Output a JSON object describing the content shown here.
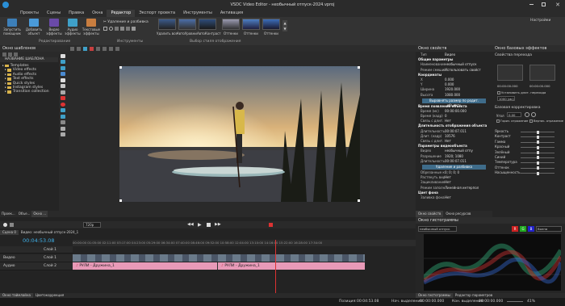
{
  "window": {
    "title": "VSDC Video Editor - необычный отпуск-2024.vproj"
  },
  "tabs": [
    "Проекты",
    "Сцены",
    "Правка",
    "Окна",
    "Редактор",
    "Экспорт проекта",
    "Инструменты",
    "Активация"
  ],
  "ribbon": {
    "start_assistant": "Запустить помощник",
    "add_object": "Добавить объект",
    "video_effects": "Видео эффекты",
    "audio_effects": "Аудио эффекты",
    "text_effects": "Текстовые эффекты",
    "group_editing": "Редактирование",
    "cut_split": "Удаление и разбивка",
    "group_tools": "Инструменты",
    "styles": [
      "Удалить все",
      "АвтоУровни",
      "АвтоКонтраст",
      "Оттенки",
      "Оттенки",
      "Оттенки"
    ],
    "group_styles": "Выбор стиля отображения",
    "settings_label": "Настройки"
  },
  "left_panel": {
    "title": "Окно шаблонов",
    "header": "НАЗВАНИЕ ШАБЛОНА",
    "items": [
      "Templates",
      "Video effects",
      "Audio effects",
      "Text effects",
      "Quick styles",
      "Instagram styles",
      "Transition collection"
    ],
    "bottom_tabs": [
      "Проек...",
      "Объе...",
      "Окно ..."
    ]
  },
  "props": {
    "title": "Окно свойств",
    "rows": [
      {
        "k": "Тип",
        "v": "Видео",
        "sec": false
      },
      {
        "k": "",
        "v": "",
        "sec": true,
        "label": "Общие параметры"
      },
      {
        "k": "Наименование",
        "v": "необычный отпуск"
      },
      {
        "k": "Режим смешивания",
        "v": "Использовать свойст"
      },
      {
        "k": "",
        "v": "",
        "sec": true,
        "label": "Координаты"
      },
      {
        "k": "X",
        "v": "0.000"
      },
      {
        "k": "Y",
        "v": "0.000"
      },
      {
        "k": "Ширина",
        "v": "1920.000"
      },
      {
        "k": "Высота",
        "v": "1080.000"
      }
    ],
    "btn1": "Выровнять размер по родит. объекту",
    "rows2": [
      {
        "k": "",
        "v": "",
        "sec": true,
        "label": "Время появления объекта"
      },
      {
        "k": "Время (мс)",
        "v": "00:00:00.000"
      },
      {
        "k": "Время (кадр)",
        "v": "0"
      },
      {
        "k": "Связь с длит.",
        "v": "Нет"
      },
      {
        "k": "",
        "v": "",
        "sec": true,
        "label": "Длительность отображения объекта"
      },
      {
        "k": "Длительность",
        "v": "00:00:07.011"
      },
      {
        "k": "Длит. (кадр)",
        "v": "10576"
      },
      {
        "k": "Связь с длит.",
        "v": "Нет"
      },
      {
        "k": "",
        "v": "",
        "sec": true,
        "label": "Параметры видеообъекта"
      },
      {
        "k": "Видео",
        "v": "необычный отпу"
      },
      {
        "k": "Разрешение",
        "v": "1920; 1080"
      },
      {
        "k": "Длительность",
        "v": "00:00:07.011"
      }
    ],
    "btn2": "Удаление и разбивка",
    "rows3": [
      {
        "k": "Обрезанные края",
        "v": "0; 0; 0; 0"
      },
      {
        "k": "Растянуть видео",
        "v": "Нет"
      },
      {
        "k": "Зацикливание",
        "v": "Нет"
      },
      {
        "k": "Режим заполнения",
        "v": "Линейная интерпол"
      },
      {
        "k": "",
        "v": "",
        "sec": true,
        "label": "Цвет фона"
      },
      {
        "k": "Заливка фона",
        "v": "Нет"
      },
      {
        "k": "Цвет",
        "v": "0; 0; 0"
      }
    ],
    "bottom_tabs": [
      "Окно свойств",
      "Окно ресурсов"
    ]
  },
  "effects": {
    "title": "Окно базовых эффектов",
    "transition_section": "Свойства перехода",
    "time_values": [
      "00:00:00.000",
      "00:00:00.000"
    ],
    "check_label": "Установить длит. перехода",
    "duration_value": "1000 (мс)",
    "color_section": "Базовая корректировка",
    "angle_label": "Угол",
    "angle_value": "0.00",
    "mirror_h": "Гориз. отражение",
    "mirror_v": "Вертик. отражение",
    "sliders": [
      {
        "name": "Яркость",
        "value": 0.5
      },
      {
        "name": "Контраст",
        "value": 0.5
      },
      {
        "name": "Гамма",
        "value": 0.5
      },
      {
        "name": "Красный",
        "value": 0.5
      },
      {
        "name": "Зелёный",
        "value": 0.5
      },
      {
        "name": "Синий",
        "value": 0.5
      },
      {
        "name": "Температура",
        "value": 0.5
      },
      {
        "name": "Оттенок",
        "value": 0.5
      },
      {
        "name": "Насыщенность",
        "value": 0.5
      }
    ]
  },
  "timeline": {
    "time": "00:04:53.08",
    "zoom": "720p",
    "scene_tab": "Сцена 0",
    "breadcrumb": "Видео: необычный отпуск-2024_1",
    "track_layer_label": "Слой 1",
    "tracks": [
      {
        "name": "Видео",
        "layer": "Слой 1"
      },
      {
        "name": "Аудио",
        "layer": "Слой 2"
      }
    ],
    "audio_clips": [
      "РУЛИ - Дружина_1",
      "РУЛИ - Дружина_1"
    ],
    "ruler": "00:00:00 01:05:00 02:11:00 03:17:00 04:23:00 05:29:00 06:34:00 07:40:00 08:46:00 09:52:00 10:58:00 12:04:00 13:10:00 14:16:00 15:22:00 16:28:00 17:34:00",
    "bottom_tabs": [
      "Окно таймлайна",
      "Цветокоррекция"
    ]
  },
  "histogram": {
    "title": "Окно гистограммы",
    "mode": "необычный отпуск",
    "channels": [
      "R",
      "G",
      "B"
    ],
    "option": "Волна",
    "bottom_tabs": [
      "Окно гистограммы",
      "Редактор параметров"
    ]
  },
  "status": {
    "position_label": "Позиция:",
    "position": "00:04:53.08",
    "start_label": "Нач. выделения:",
    "start": "00:00:00.000",
    "end_label": "Кон. выделения:",
    "end": "00:00:00.000",
    "zoom": "41%"
  }
}
